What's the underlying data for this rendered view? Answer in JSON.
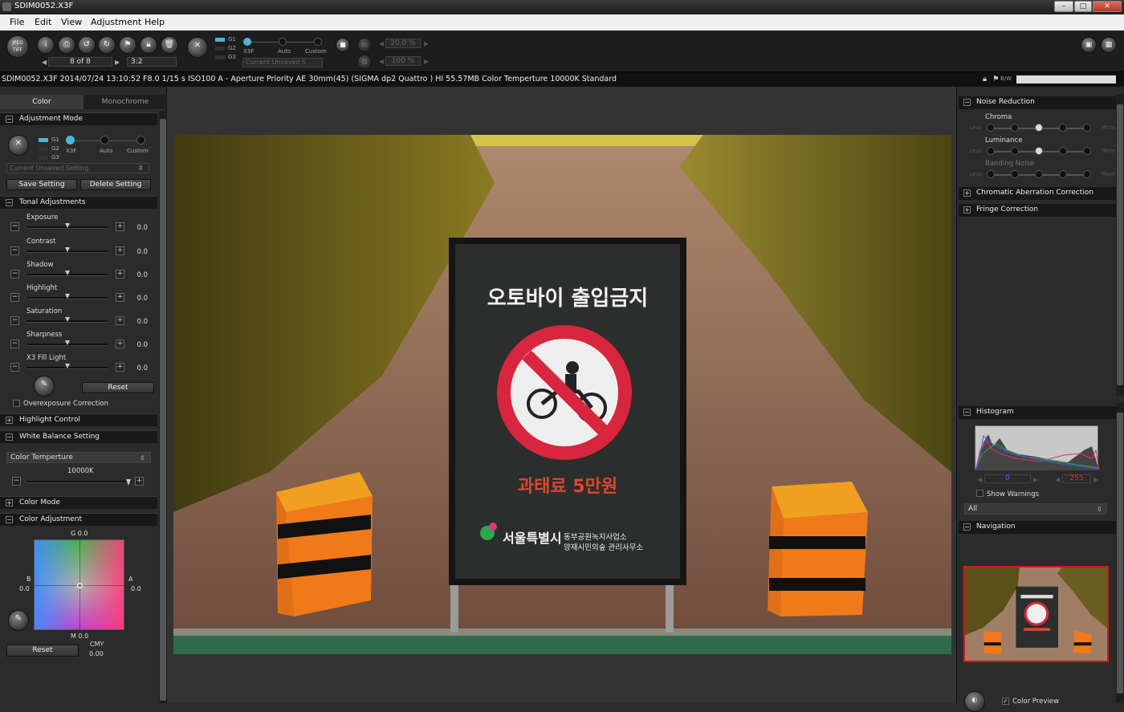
{
  "window": {
    "title": "SDIM0052.X3F",
    "controls": [
      "–",
      "□",
      "✕"
    ]
  },
  "menu": [
    "File",
    "Edit",
    "View",
    "Adjustment",
    "Help"
  ],
  "toolbar": {
    "format_btn": "JPEG TIFF",
    "nav_count": "8 of 8",
    "crop_ratio": "3:2",
    "mode_labels": {
      "g1": "G1",
      "g2": "G2",
      "g3": "G3",
      "x3f": "X3F",
      "auto": "Auto",
      "custom": "Custom"
    },
    "setting_select": "Current Unsaved S",
    "zoom1": "20.0 %",
    "zoom2": "100 %"
  },
  "infobar": {
    "text": "SDIM0052.X3F 2014/07/24 13:10:52 F8.0 1/15 s ISO100 A - Aperture Priority AE 30mm(45) (SIGMA dp2 Quattro ) HI 55.57MB Color Temperture 10000K Standard",
    "bw_label": "B/W"
  },
  "left": {
    "tabs": [
      "Color",
      "Monochrome"
    ],
    "adjustment_mode": {
      "header": "Adjustment Mode",
      "g1": "G1",
      "g2": "G2",
      "g3": "G3",
      "x3f": "X3F",
      "auto": "Auto",
      "custom": "Custom",
      "setting_placeholder": "Current Unsaved Setting",
      "save": "Save Setting",
      "delete": "Delete Setting"
    },
    "tonal": {
      "header": "Tonal Adjustments",
      "sliders": [
        {
          "label": "Exposure",
          "value": "0.0"
        },
        {
          "label": "Contrast",
          "value": "0.0"
        },
        {
          "label": "Shadow",
          "value": "0.0"
        },
        {
          "label": "Highlight",
          "value": "0.0"
        },
        {
          "label": "Saturation",
          "value": "0.0"
        },
        {
          "label": "Sharpness",
          "value": "0.0"
        },
        {
          "label": "X3 Fill Light",
          "value": "0.0"
        }
      ],
      "reset": "Reset",
      "overexposure": "Overexposure Correction"
    },
    "highlight_control": "Highlight Control",
    "white_balance": {
      "header": "White Balance Setting",
      "mode": "Color Temperture",
      "value": "10000K"
    },
    "color_mode": "Color Mode",
    "color_adjustment": {
      "header": "Color Adjustment",
      "g": "G 0.0",
      "b": "B",
      "b_val": "0.0",
      "a": "A",
      "a_val": "0.0",
      "m": "M 0.0",
      "cmy": "CMY",
      "cmy_val": "0.00",
      "reset": "Reset"
    }
  },
  "photo": {
    "sign_title": "오토바이 출입금지",
    "sign_fine": "과태료 5만원",
    "sign_city": "서울특별시",
    "sign_office1": "동부공원녹지사업소",
    "sign_office2": "양재시민의숲 관리사무소"
  },
  "right": {
    "noise": {
      "header": "Noise Reduction",
      "rows": [
        {
          "label": "Chroma",
          "less": "Less",
          "more": "More",
          "level": 0.5
        },
        {
          "label": "Luminance",
          "less": "Less",
          "more": "More",
          "level": 0.5
        },
        {
          "label": "Banding Noise",
          "less": "Less",
          "more": "More",
          "level": 0
        }
      ]
    },
    "chromatic": "Chromatic Aberration Correction",
    "fringe": "Fringe Correction",
    "histogram": {
      "header": "Histogram",
      "low": "0",
      "high": "255",
      "warnings": "Show Warnings",
      "channel": "All"
    },
    "navigation": {
      "header": "Navigation",
      "color_preview": "Color Preview"
    }
  },
  "colors": {
    "accent": "#4fb3d9",
    "panel": "#2b2b2b",
    "header": "#181818",
    "highlight_red": "#c81d1d"
  }
}
